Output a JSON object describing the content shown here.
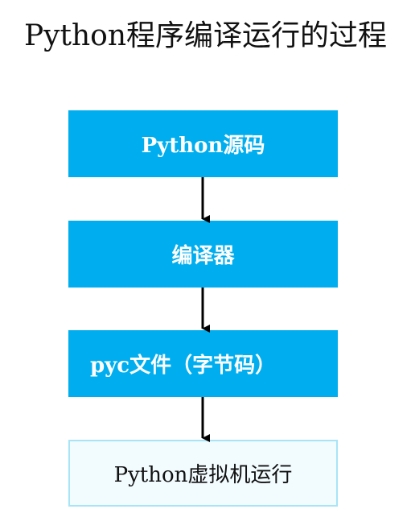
{
  "title": "Python程序编译运行的过程",
  "nodes": {
    "source": "Python源码",
    "compiler": "编译器",
    "pyc": "pyc文件（字节码）",
    "vm": "Python虚拟机运行"
  },
  "colors": {
    "filled_box": "#00aeef",
    "outline_box_fill": "#f2fbfe",
    "outline_box_border": "#a8e4f7",
    "arrow": "#000000"
  }
}
